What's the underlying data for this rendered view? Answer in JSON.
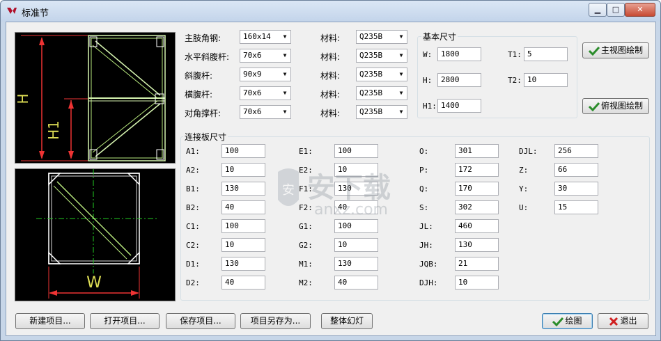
{
  "window": {
    "title": "标准节"
  },
  "angles": [
    {
      "label": "主肢角钢:",
      "value": "160x14",
      "mat_label": "材料:",
      "mat_value": "Q235B"
    },
    {
      "label": "水平斜腹杆:",
      "value": "70x6",
      "mat_label": "材料:",
      "mat_value": "Q235B"
    },
    {
      "label": "斜腹杆:",
      "value": "90x9",
      "mat_label": "材料:",
      "mat_value": "Q235B"
    },
    {
      "label": "横腹杆:",
      "value": "70x6",
      "mat_label": "材料:",
      "mat_value": "Q235B"
    },
    {
      "label": "对角撑杆:",
      "value": "70x6",
      "mat_label": "材料:",
      "mat_value": "Q235B"
    }
  ],
  "basic": {
    "title": "基本尺寸",
    "W": {
      "label": "W:",
      "value": "1800"
    },
    "H": {
      "label": "H:",
      "value": "2800"
    },
    "H1": {
      "label": "H1:",
      "value": "1400"
    },
    "T1": {
      "label": "T1:",
      "value": "5"
    },
    "T2": {
      "label": "T2:",
      "value": "10"
    }
  },
  "side_buttons": {
    "main_view": "主视图绘制",
    "top_view": "俯视图绘制"
  },
  "plate": {
    "title": "连接板尺寸",
    "col1": [
      {
        "label": "A1:",
        "value": "100"
      },
      {
        "label": "A2:",
        "value": "10"
      },
      {
        "label": "B1:",
        "value": "130"
      },
      {
        "label": "B2:",
        "value": "40"
      },
      {
        "label": "C1:",
        "value": "100"
      },
      {
        "label": "C2:",
        "value": "10"
      },
      {
        "label": "D1:",
        "value": "130"
      },
      {
        "label": "D2:",
        "value": "40"
      }
    ],
    "col2": [
      {
        "label": "E1:",
        "value": "100"
      },
      {
        "label": "E2:",
        "value": "10"
      },
      {
        "label": "F1:",
        "value": "130"
      },
      {
        "label": "F2:",
        "value": "40"
      },
      {
        "label": "G1:",
        "value": "100"
      },
      {
        "label": "G2:",
        "value": "10"
      },
      {
        "label": "M1:",
        "value": "130"
      },
      {
        "label": "M2:",
        "value": "40"
      }
    ],
    "col3": [
      {
        "label": "O:",
        "value": "301"
      },
      {
        "label": "P:",
        "value": "172"
      },
      {
        "label": "Q:",
        "value": "170"
      },
      {
        "label": "S:",
        "value": "302"
      },
      {
        "label": "JL:",
        "value": "460"
      },
      {
        "label": "JH:",
        "value": "130"
      },
      {
        "label": "JQB:",
        "value": "21"
      },
      {
        "label": "DJH:",
        "value": "10"
      }
    ],
    "col4": [
      {
        "label": "DJL:",
        "value": "256"
      },
      {
        "label": "Z:",
        "value": "66"
      },
      {
        "label": "Y:",
        "value": "30"
      },
      {
        "label": "U:",
        "value": "15"
      }
    ]
  },
  "drawing_labels": {
    "H": "H",
    "H1": "H1",
    "W": "W"
  },
  "bottom_buttons": {
    "new_project": "新建项目...",
    "open_project": "打开项目...",
    "save_project": "保存项目...",
    "save_as": "项目另存为...",
    "slideshow": "整体幻灯",
    "draw": "绘图",
    "exit": "退出"
  },
  "watermark": {
    "text": "安下载",
    "sub": "anxz.com"
  }
}
